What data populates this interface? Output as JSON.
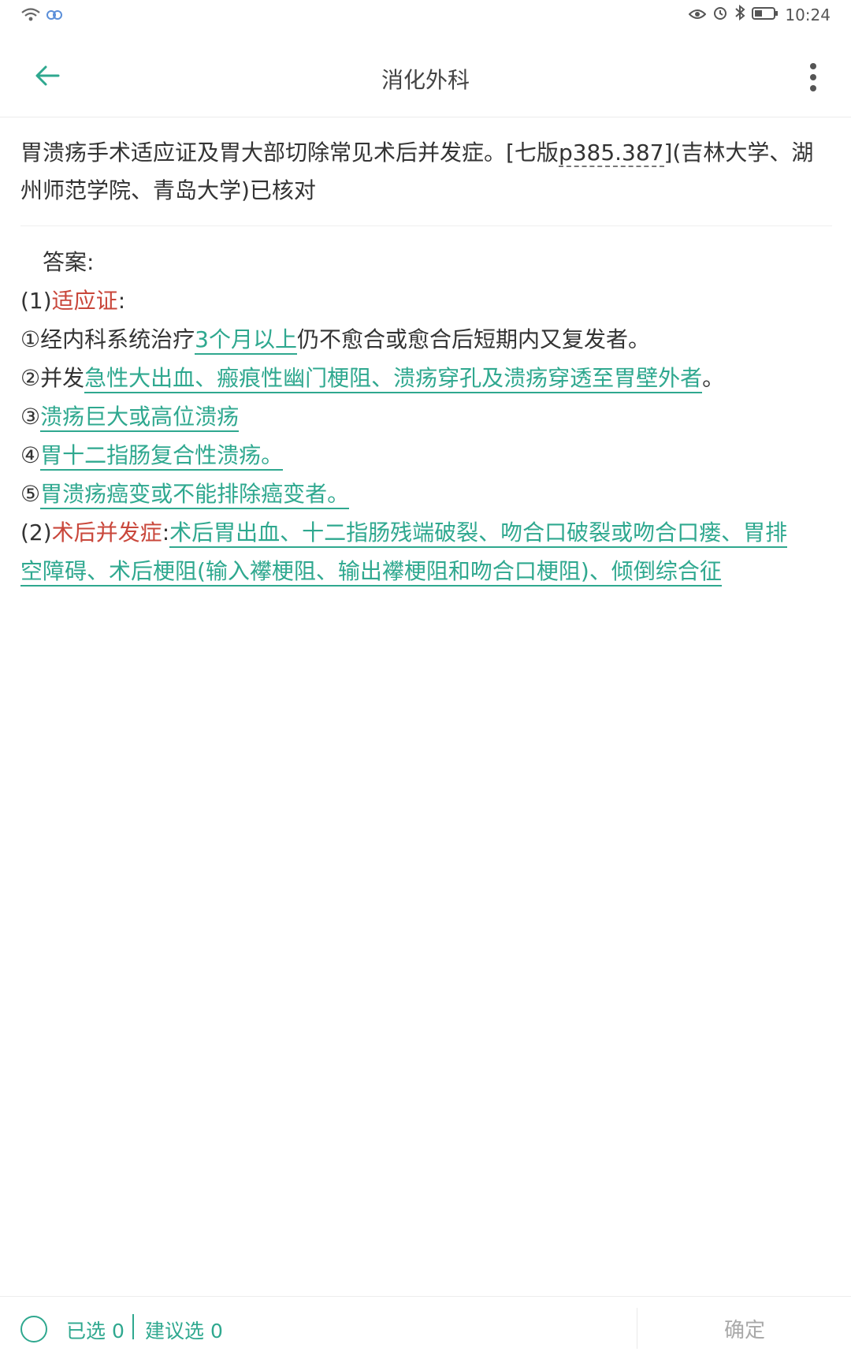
{
  "status_bar": {
    "time": "10:24"
  },
  "app_bar": {
    "title": "消化外科"
  },
  "question": {
    "text_before": "胃溃疡手术适应证及胃大部切除常见术后并发症。[七版",
    "ref": "p385.387",
    "text_after": "](吉林大学、湖州师范学院、青岛大学)已核对"
  },
  "answer": {
    "label": "答案:",
    "part1": {
      "prefix": "(1)",
      "title": "适应证",
      "suffix": ":"
    },
    "items": [
      {
        "num": "①",
        "pre": "经内科系统治疗",
        "hl": "3个月以上",
        "post": "仍不愈合或愈合后短期内又复发者。"
      },
      {
        "num": "②",
        "pre": "并发",
        "hl": "急性大出血、瘢痕性幽门梗阻、溃疡穿孔及溃疡穿透至胃壁外者",
        "post": "。"
      },
      {
        "num": "③",
        "pre": "",
        "hl": "溃疡巨大或高位溃疡",
        "post": ""
      },
      {
        "num": "④",
        "pre": "",
        "hl": "胃十二指肠复合性溃疡。",
        "post": ""
      },
      {
        "num": "⑤",
        "pre": "",
        "hl": "胃溃疡癌变或不能排除癌变者。",
        "post": ""
      }
    ],
    "part2": {
      "prefix": "(2)",
      "title": "术后并发症",
      "suffix": ":",
      "hl_line1": "术后胃出血、十二指肠残端破裂、吻合口破裂或吻合口瘘、胃排",
      "hl_line2": "空障碍、术后梗阻(输入襻梗阻、输出襻梗阻和吻合口梗阻)、倾倒综合征"
    }
  },
  "bottom_bar": {
    "selected": "已选 0",
    "suggested": "建议选 0",
    "confirm": "确定"
  },
  "colors": {
    "accent": "#2fa88f",
    "red": "#c9473b",
    "text": "#333333"
  },
  "icons": [
    "wifi-icon",
    "cloud-sync-icon",
    "eye-icon",
    "alarm-icon",
    "bluetooth-icon",
    "battery-icon",
    "back-arrow-icon",
    "more-vert-icon"
  ]
}
